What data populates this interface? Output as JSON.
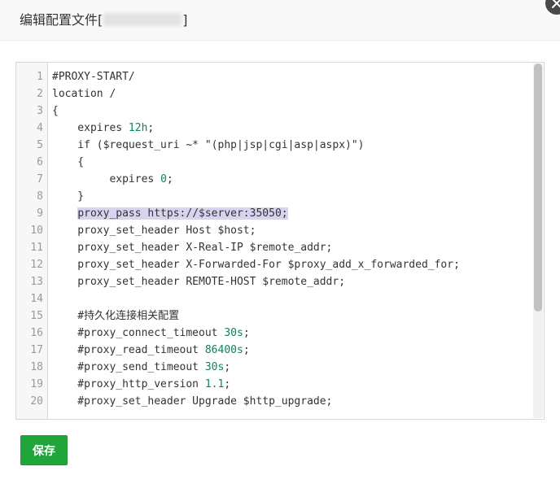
{
  "dialog": {
    "title_prefix": "编辑配置文件[",
    "title_suffix": "]",
    "close_icon": "close-icon"
  },
  "editor": {
    "lines": [
      {
        "n": "1",
        "code": "#PROXY-START/"
      },
      {
        "n": "2",
        "code": "location /"
      },
      {
        "n": "3",
        "code": "{"
      },
      {
        "n": "4",
        "code": "    expires 12h;"
      },
      {
        "n": "5",
        "code": "    if ($request_uri ~* \"(php|jsp|cgi|asp|aspx)\")"
      },
      {
        "n": "6",
        "code": "    {"
      },
      {
        "n": "7",
        "code": "         expires 0;"
      },
      {
        "n": "8",
        "code": "    }"
      },
      {
        "n": "9",
        "code": "    proxy_pass https://$server:35050;"
      },
      {
        "n": "10",
        "code": "    proxy_set_header Host $host;"
      },
      {
        "n": "11",
        "code": "    proxy_set_header X-Real-IP $remote_addr;"
      },
      {
        "n": "12",
        "code": "    proxy_set_header X-Forwarded-For $proxy_add_x_forwarded_for;"
      },
      {
        "n": "13",
        "code": "    proxy_set_header REMOTE-HOST $remote_addr;"
      },
      {
        "n": "14",
        "code": ""
      },
      {
        "n": "15",
        "code": "    #持久化连接相关配置"
      },
      {
        "n": "16",
        "code": "    #proxy_connect_timeout 30s;"
      },
      {
        "n": "17",
        "code": "    #proxy_read_timeout 86400s;"
      },
      {
        "n": "18",
        "code": "    #proxy_send_timeout 30s;"
      },
      {
        "n": "19",
        "code": "    #proxy_http_version 1.1;"
      },
      {
        "n": "20",
        "code": "    #proxy_set_header Upgrade $http_upgrade;"
      }
    ],
    "highlighted_line": "9"
  },
  "actions": {
    "save_label": "保存"
  },
  "colors": {
    "save_button": "#20a53a",
    "selection": "#d7d4f0",
    "number": "#098658"
  }
}
